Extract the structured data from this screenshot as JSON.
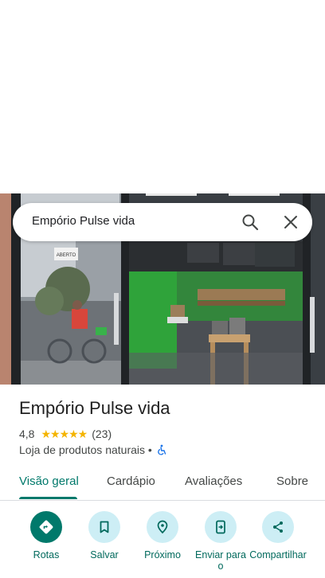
{
  "search": {
    "query": "Empório Pulse vida"
  },
  "place": {
    "name": "Empório Pulse vida",
    "rating": "4,8",
    "stars": "★★★★★",
    "reviews_count": "(23)",
    "category": "Loja de produtos naturais •",
    "accessibility_icon": "wheelchair-icon"
  },
  "tabs": [
    {
      "label": "Visão geral",
      "active": true
    },
    {
      "label": "Cardápio"
    },
    {
      "label": "Avaliações"
    },
    {
      "label": "Sobre"
    }
  ],
  "actions": [
    {
      "label": "Rotas",
      "icon": "directions-icon"
    },
    {
      "label": "Salvar",
      "icon": "bookmark-icon"
    },
    {
      "label": "Próximo",
      "icon": "nearby-icon"
    },
    {
      "label": "Enviar para o",
      "icon": "send-to-phone-icon"
    },
    {
      "label": "Compartilhar",
      "icon": "share-icon"
    }
  ],
  "photo": {
    "sign_text": "ABERTO"
  },
  "colors": {
    "accent": "#00796b",
    "action_bg": "#cdeef5",
    "star": "#f4b400"
  }
}
